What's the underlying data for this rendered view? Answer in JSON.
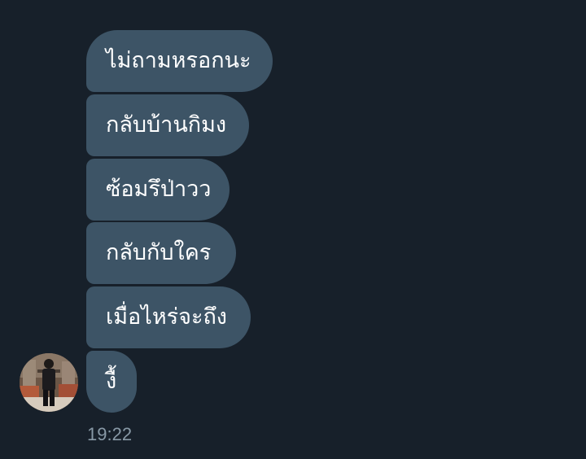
{
  "conversation": {
    "messages": [
      {
        "text": "ไม่ถามหรอกนะ"
      },
      {
        "text": "กลับบ้านกิมง"
      },
      {
        "text": "ซ้อมรึป่าวว"
      },
      {
        "text": "กลับกับใคร"
      },
      {
        "text": "เมื่อไหร่จะถึง"
      },
      {
        "text": "งื้"
      }
    ],
    "timestamp": "19:22"
  },
  "colors": {
    "background": "#17202a",
    "bubble": "#3d5466",
    "bubble_text": "#ffffff",
    "timestamp_text": "#8899a6"
  }
}
